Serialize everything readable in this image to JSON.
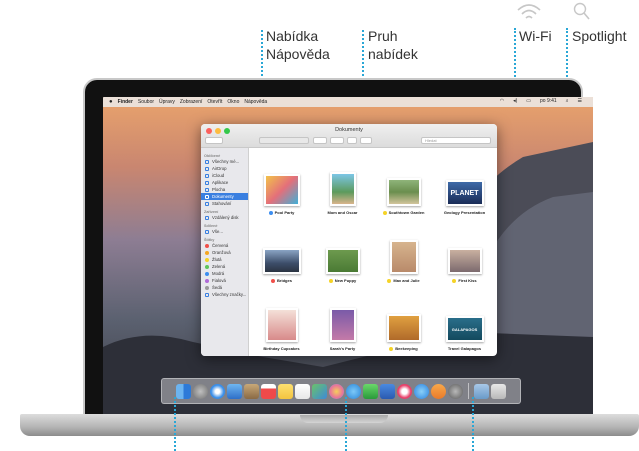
{
  "callouts": {
    "help_menu": [
      "Nabídka",
      "Nápověda"
    ],
    "menu_bar": [
      "Pruh",
      "nabídek"
    ],
    "wifi": "Wi-Fi",
    "spotlight": "Spotlight"
  },
  "menubar": {
    "items": [
      "",
      "Finder",
      "Soubor",
      "Úpravy",
      "Zobrazení",
      "Otevřít",
      "Okno",
      "Nápověda"
    ],
    "clock": "po 9:41"
  },
  "finder": {
    "title": "Dokumenty",
    "search_placeholder": "Hledat",
    "sidebar": [
      {
        "head": "Oblíbené"
      },
      {
        "label": "Všechny mé..."
      },
      {
        "label": "AirDrop"
      },
      {
        "label": "iCloud"
      },
      {
        "label": "Aplikace"
      },
      {
        "label": "Plocha"
      },
      {
        "label": "Dokumenty",
        "selected": true
      },
      {
        "label": "Stahování"
      },
      {
        "head": "Zařízení"
      },
      {
        "label": "Vzdálený disk"
      },
      {
        "head": "Sdílené"
      },
      {
        "label": "Vše..."
      },
      {
        "head": "Štítky"
      },
      {
        "label": "Červená",
        "color": "#f0504a"
      },
      {
        "label": "Oranžová",
        "color": "#f5a623"
      },
      {
        "label": "Žlutá",
        "color": "#f5d327"
      },
      {
        "label": "Zelená",
        "color": "#5fc55b"
      },
      {
        "label": "Modrá",
        "color": "#3c8ef0"
      },
      {
        "label": "Fialová",
        "color": "#b06ad8"
      },
      {
        "label": "Šedá",
        "color": "#9a9a9a"
      },
      {
        "label": "Všechny značky..."
      }
    ],
    "files": [
      {
        "label": "Pool Party",
        "tag": "#3c8ef0"
      },
      {
        "label": "Mom and Oscar",
        "tag": ""
      },
      {
        "label": "Southtown Garden",
        "tag": "#f5d327"
      },
      {
        "label": "Geology Presentation",
        "tag": ""
      },
      {
        "label": "Bridges",
        "tag": "#f0504a"
      },
      {
        "label": "New Puppy",
        "tag": "#f5d327"
      },
      {
        "label": "Max and Julie",
        "tag": "#f5d327"
      },
      {
        "label": "First Kiss",
        "tag": "#f5d327"
      },
      {
        "label": "Birthday Cupcakes",
        "tag": ""
      },
      {
        "label": "Sarah's Party",
        "tag": ""
      },
      {
        "label": "Beekeeping",
        "tag": "#f5d327"
      },
      {
        "label": "Travel Galapagos",
        "tag": ""
      }
    ],
    "thumb_texts": {
      "planet": "PLANET",
      "galapagos": "GALAPAGOS"
    }
  },
  "colors": {
    "accent": "#2aa7d6",
    "selection": "#3a7fe0"
  }
}
